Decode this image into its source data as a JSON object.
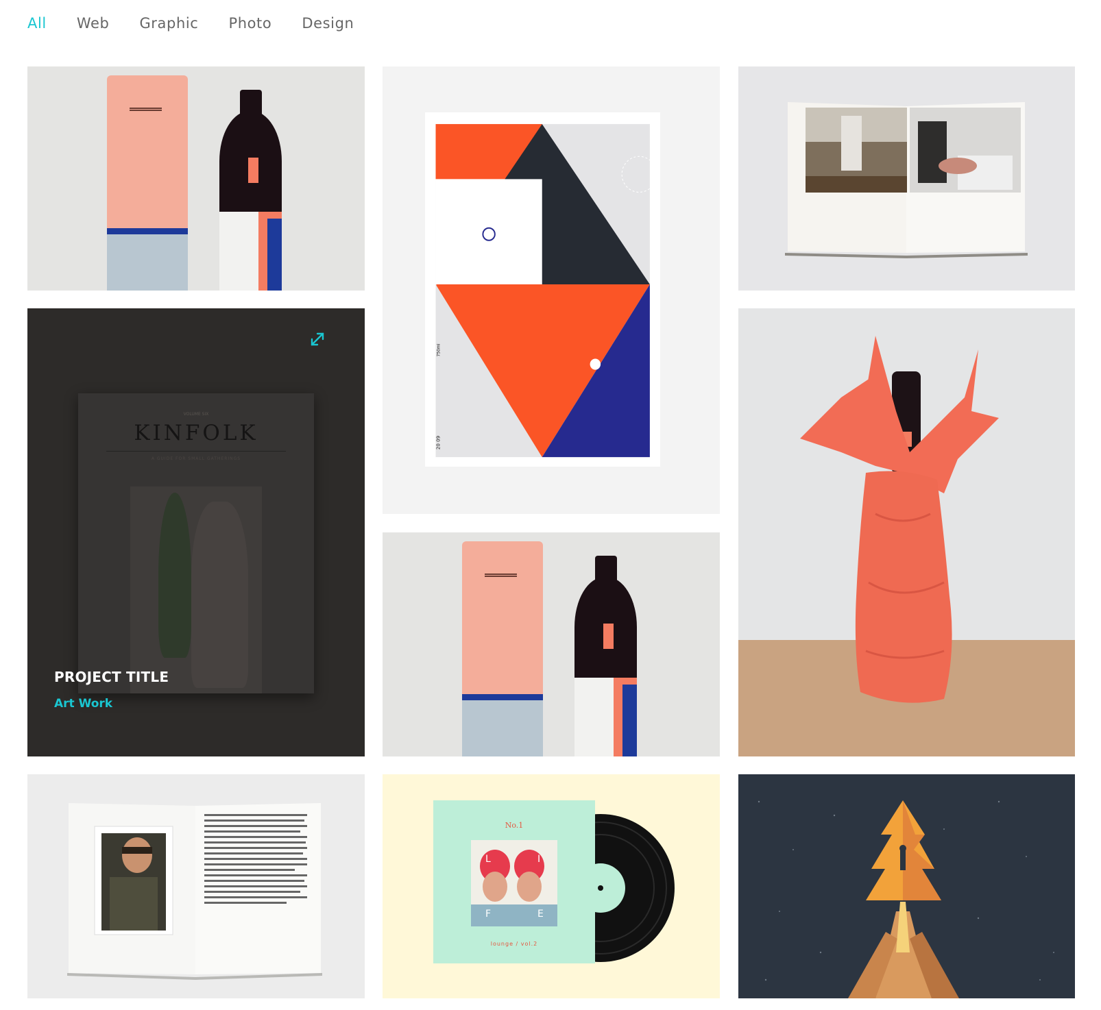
{
  "filters": [
    {
      "label": "All",
      "active": true
    },
    {
      "label": "Web",
      "active": false
    },
    {
      "label": "Graphic",
      "active": false
    },
    {
      "label": "Photo",
      "active": false
    },
    {
      "label": "Design",
      "active": false
    }
  ],
  "hover_card": {
    "title": "PROJECT TITLE",
    "category": "Art Work",
    "magazine_title": "KINFOLK",
    "magazine_volume": "VOLUME SIX",
    "magazine_subtitle": "A GUIDE FOR SMALL GATHERINGS"
  },
  "tiles": [
    {
      "name": "gift-box-tile",
      "subject": "gift tube and wine bottle"
    },
    {
      "name": "geometric-poster-tile",
      "subject": "geometric poster"
    },
    {
      "name": "photo-book-tile",
      "subject": "open photo book"
    },
    {
      "name": "kinfolk-tile",
      "subject": "kinfolk magazine"
    },
    {
      "name": "gift-box-tile-2",
      "subject": "gift tube and wine bottle"
    },
    {
      "name": "wrapped-bottle-tile",
      "subject": "bottle wrapped in paper"
    },
    {
      "name": "magazine-spread-tile",
      "subject": "magazine spread"
    },
    {
      "name": "vinyl-record-tile",
      "subject": "vinyl record sleeve"
    },
    {
      "name": "christmas-tree-tile",
      "subject": "christmas tree illustration"
    }
  ],
  "vinyl": {
    "heading": "No.1",
    "caption": "lounge / vol.2",
    "letters": [
      "L",
      "I",
      "F",
      "E"
    ]
  },
  "poster": {
    "year": "20 09",
    "volume": "750ml"
  },
  "colors": {
    "accent": "#1ac6d1",
    "filter_text": "#666666",
    "card_overlay": "#2d2b29",
    "poster_orange": "#fb5526",
    "poster_navy": "#262a8f",
    "poster_dark": "#262b33"
  }
}
